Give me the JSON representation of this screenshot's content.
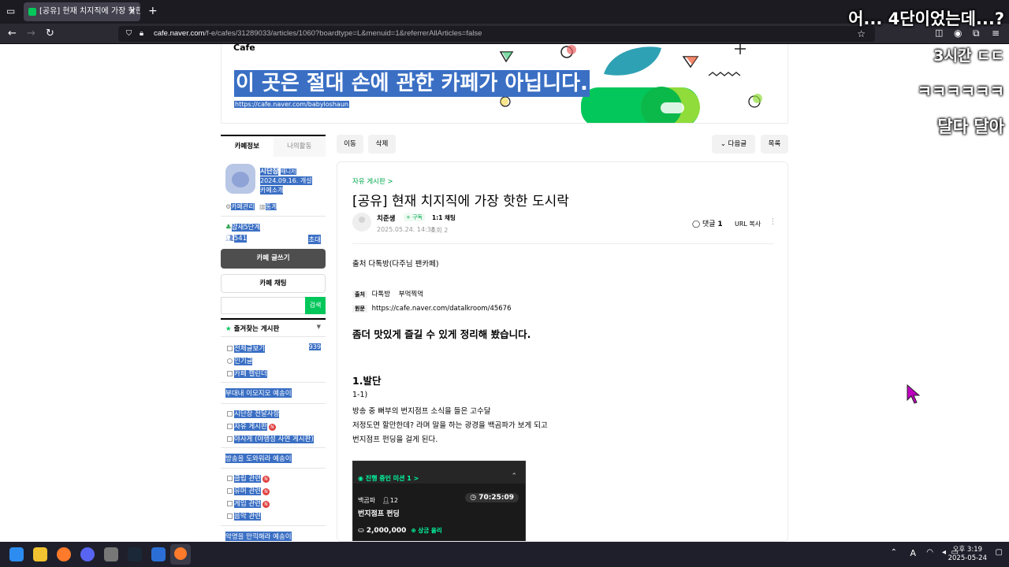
{
  "browser": {
    "tab_title": "[공유] 현재 치지직에 가장 핫한",
    "new_tab": "+",
    "url_host": "cafe.naver.com",
    "url_path": "/f-e/cafes/31289033/articles/1060?boardtype=L&menuid=1&referrerAllArticles=false"
  },
  "overlay": {
    "line1": "어... 4단이었는데...?",
    "line2": "3시간 ㄷㄷ",
    "line3": "ㅋㅋㅋㅋㅋㅋ",
    "line4": "달다 달아"
  },
  "banner": {
    "cafe_label": "Cafe",
    "title": "이 곳은 절대 손에 관한 카페가 아닙니다.",
    "url": "https://cafe.naver.com/babyloshaun"
  },
  "sidebar": {
    "tab_info": "카페정보",
    "tab_activity": "나의활동",
    "manager_name": "시단장",
    "manager_badge": "매니저",
    "founded": "2024.09.16. 개설",
    "intro": "카페소개",
    "cafe_manage": "카페관리",
    "stats": "통계",
    "level": "얍새5단계",
    "members": "541",
    "invite": "초대",
    "write_btn": "카페 글쓰기",
    "chat_btn": "카페 채팅",
    "search_btn": "검색",
    "favorites": "즐겨찾는 게시판",
    "boards1": [
      {
        "label": "전체글보기",
        "count": "939"
      },
      {
        "label": "인기글"
      },
      {
        "label": "카페 캘린더"
      }
    ],
    "group1": "부대내 이모지모 예송이",
    "boards2": [
      {
        "label": "시단장 전달사항"
      },
      {
        "label": "자유 게시판",
        "new": "N"
      },
      {
        "label": "야사게 (야행성 사연 게시판)"
      }
    ],
    "group2": "방송을 도와워라 예송이",
    "boards3": [
      {
        "label": "클립 관련",
        "new": "N"
      },
      {
        "label": "유머 관련",
        "new": "N"
      },
      {
        "label": "게임 관련",
        "new": "N"
      },
      {
        "label": "음악 관련"
      }
    ],
    "group3": "악명을 만끽해라 예송이"
  },
  "toolbar": {
    "move": "이동",
    "delete": "삭제",
    "next": "다음글",
    "list": "목록"
  },
  "article": {
    "board": "자유 게시판 >",
    "title": "[공유] 현재 치지직에 가장 핫한 도시락",
    "author": "치준생",
    "subscribe": "+ 구독",
    "chat": "1:1 채팅",
    "date": "2025.05.24. 14:38",
    "views": "조회 2",
    "comments_label": "댓글",
    "comments_count": "1",
    "copy_url": "URL 복사",
    "source_line": "출처 다톡방(다주님 팬카페)",
    "src_tag": "출처",
    "src_name": "다톡방",
    "src_board": "부먹찍먹",
    "orig_tag": "원문",
    "orig_url": "https://cafe.naver.com/datalkroom/45676",
    "heading": "좀더 맛있게 즐길 수 있게 정리해 봤습니다.",
    "section": "1.발단",
    "sub": "1-1)",
    "body1": "방송 중 뻐부의 번지점프 소식을 들은 고수달",
    "body2": "저정도면 할만한데? 라며 말을 하는 광경을 백곰파가 보게 되고",
    "body3": "번지점프 펀딩을 걸게 된다."
  },
  "mission": {
    "header": "진행 중인 미션 1 >",
    "streamer": "백곰파",
    "people": "12",
    "timer": "70:25:09",
    "name": "번지점프 펀딩",
    "amount": "2,000,000",
    "bonus": "상금 올리"
  },
  "taskbar": {
    "time": "오후 3:19",
    "date": "2025-05-24",
    "ime": "A"
  }
}
